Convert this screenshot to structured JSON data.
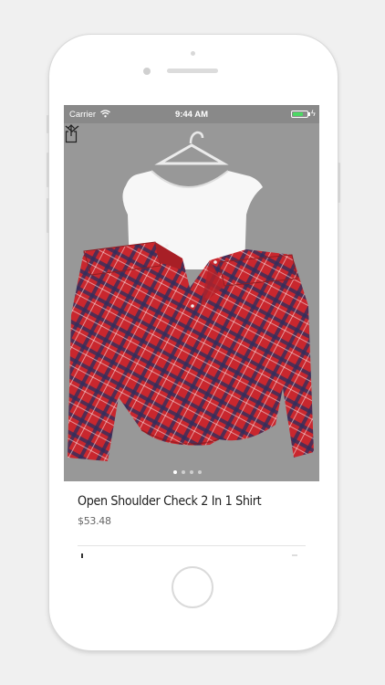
{
  "status_bar": {
    "carrier": "Carrier",
    "time": "9:44 AM",
    "battery_color": "#4cd964"
  },
  "product": {
    "title": "Open Shoulder Check 2 In 1 Shirt",
    "price": "$53.48",
    "image_dots": 4,
    "active_dot": 1
  },
  "icons": {
    "collapse": "chevron-down-icon",
    "share": "share-icon",
    "wifi": "wifi-icon"
  },
  "colors": {
    "status_bar": "#898989",
    "image_background": "#989898",
    "shirt_red": "#c9272e",
    "plaid_navy": "#2b2f5e"
  }
}
